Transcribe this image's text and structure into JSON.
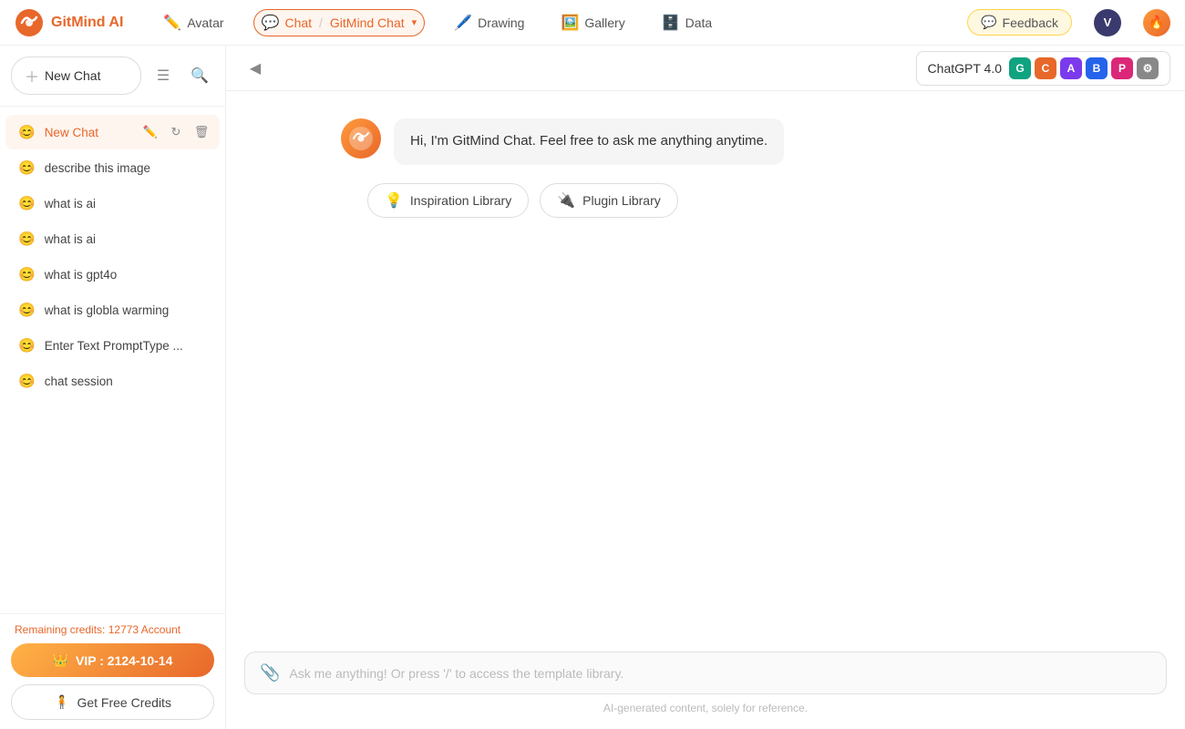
{
  "app": {
    "name": "GitMind AI"
  },
  "topnav": {
    "avatar_label": "Avatar",
    "chat_label": "Chat",
    "active_chat_label": "GitMind Chat",
    "drawing_label": "Drawing",
    "gallery_label": "Gallery",
    "data_label": "Data",
    "feedback_label": "Feedback",
    "user_initial": "V"
  },
  "sidebar": {
    "new_chat_label": "New Chat",
    "active_item": {
      "label": "New Chat"
    },
    "items": [
      {
        "label": "describe this image"
      },
      {
        "label": "what is ai"
      },
      {
        "label": "what is ai"
      },
      {
        "label": "what is gpt4o"
      },
      {
        "label": "what is globla warming"
      },
      {
        "label": "Enter Text PromptType ..."
      },
      {
        "label": "chat session"
      }
    ],
    "remaining_credits_prefix": "Remaining credits: ",
    "remaining_credits_value": "12773",
    "remaining_credits_suffix": " Account",
    "vip_label": "VIP : 2124-10-14",
    "get_credits_label": "Get Free Credits"
  },
  "chat_header": {
    "model_label": "ChatGPT 4.0"
  },
  "chat": {
    "welcome_message": "Hi, I'm GitMind Chat. Feel free to ask me anything anytime.",
    "inspiration_library_label": "Inspiration Library",
    "plugin_library_label": "Plugin Library",
    "input_placeholder": "Ask me anything! Or press '/' to access the template library.",
    "disclaimer": "AI-generated content, solely for reference."
  }
}
